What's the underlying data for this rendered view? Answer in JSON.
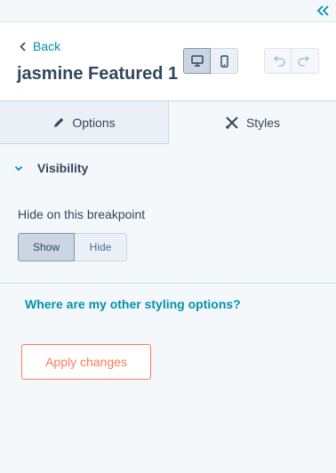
{
  "colors": {
    "link": "#0091ae",
    "text": "#33475b",
    "accent": "#ff7a59",
    "border": "#cbd6e2",
    "panel_bg": "#f5f8fa"
  },
  "topbar": {
    "collapse_icon": "double-chevron-left-icon"
  },
  "header": {
    "back_label": "Back",
    "title": "jasmine Featured 1",
    "device_buttons": [
      {
        "icon": "desktop-icon",
        "selected": true
      },
      {
        "icon": "mobile-icon",
        "selected": false
      }
    ],
    "history_buttons": [
      {
        "icon": "undo-icon",
        "enabled": false
      },
      {
        "icon": "redo-icon",
        "enabled": false
      }
    ]
  },
  "tabs": [
    {
      "label": "Options",
      "icon": "pencil-icon",
      "active": false
    },
    {
      "label": "Styles",
      "icon": "styles-icon",
      "active": true
    }
  ],
  "visibility": {
    "section_label": "Visibility",
    "field_label": "Hide on this breakpoint",
    "options": [
      "Show",
      "Hide"
    ],
    "selected": "Show"
  },
  "help_link": "Where are my other styling options?",
  "apply_button": "Apply changes"
}
